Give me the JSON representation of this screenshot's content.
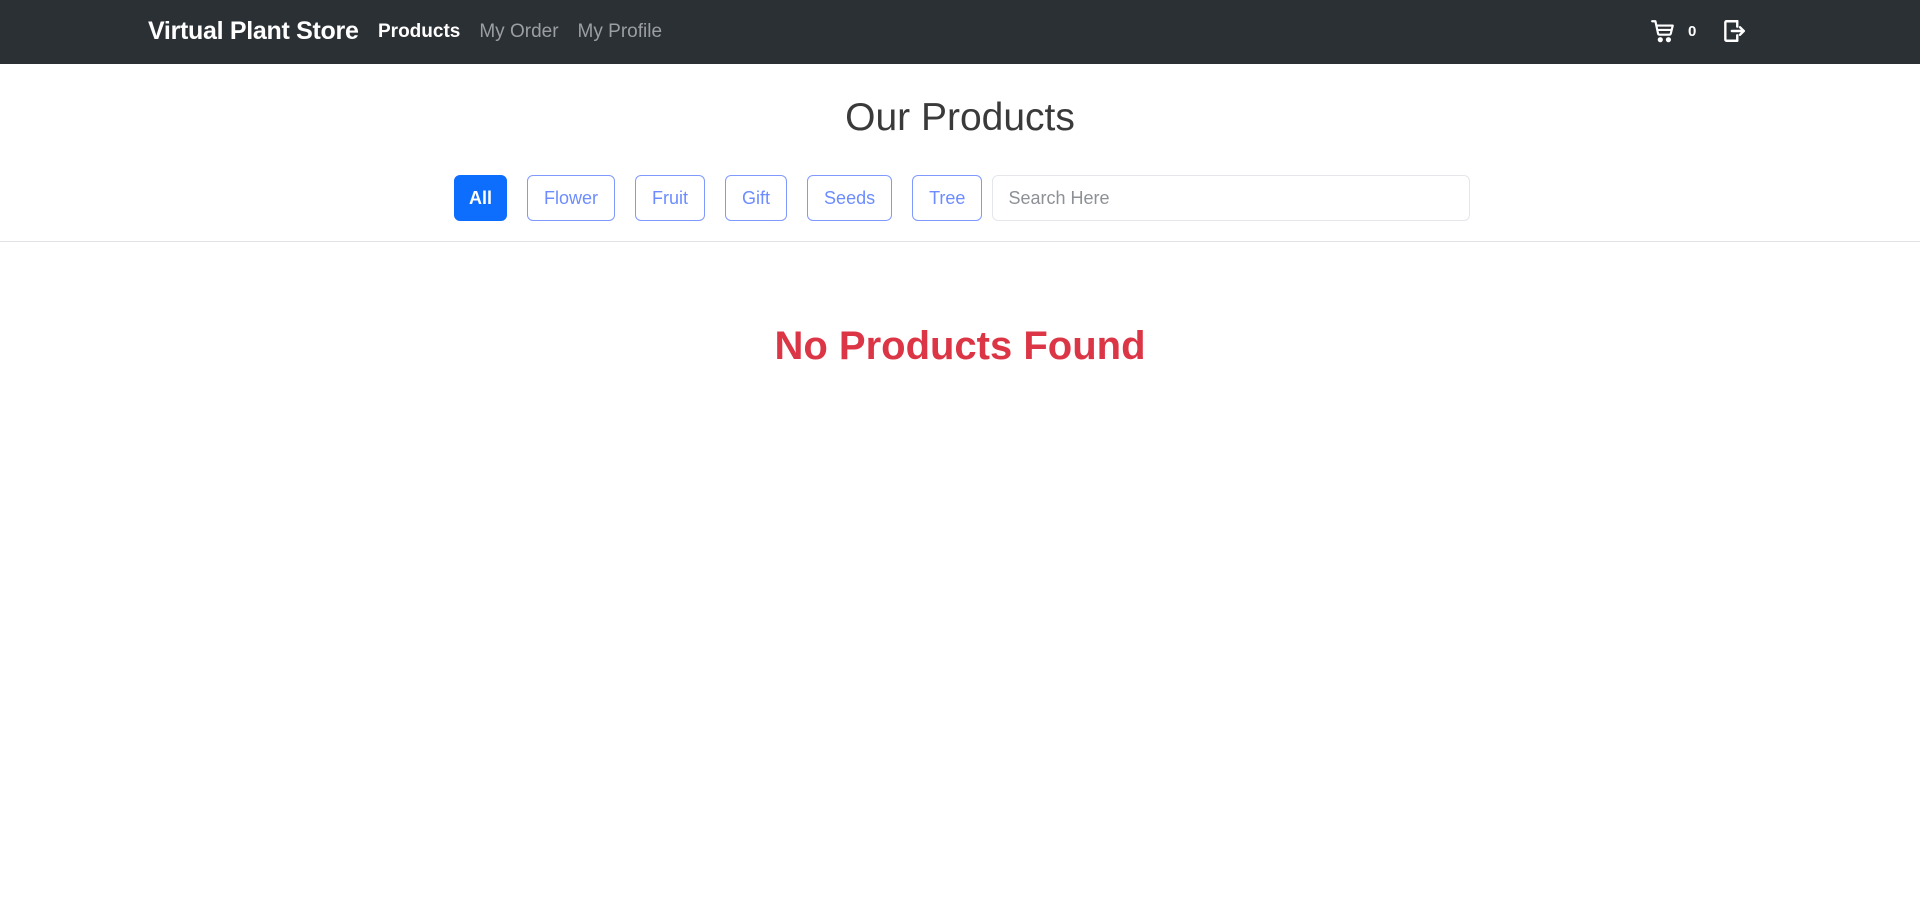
{
  "navbar": {
    "brand": "Virtual Plant Store",
    "links": [
      {
        "label": "Products",
        "active": true
      },
      {
        "label": "My Order",
        "active": false
      },
      {
        "label": "My Profile",
        "active": false
      }
    ],
    "cart_count": "0",
    "cart_icon": "cart-icon",
    "logout_icon": "logout-icon"
  },
  "main": {
    "title": "Our Products",
    "filters": [
      {
        "label": "All",
        "active": true
      },
      {
        "label": "Flower",
        "active": false
      },
      {
        "label": "Fruit",
        "active": false
      },
      {
        "label": "Gift",
        "active": false
      },
      {
        "label": "Seeds",
        "active": false
      },
      {
        "label": "Tree",
        "active": false
      }
    ],
    "search": {
      "placeholder": "Search Here",
      "value": ""
    },
    "empty_message": "No Products Found"
  },
  "colors": {
    "navbar_bg": "#2b3035",
    "primary": "#0d6efd",
    "empty_text": "#dc3545"
  }
}
